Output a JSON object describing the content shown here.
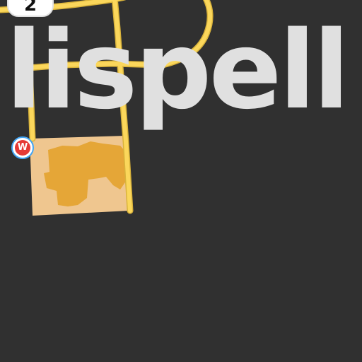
{
  "map": {
    "background_color": "#303030",
    "road_color": "#fbd75b",
    "landuse_color": "#efc68f",
    "building_color": "#e5a637",
    "city_label": {
      "text": "lispell",
      "color": "#e0e0e0"
    },
    "route_shield": {
      "number": "2",
      "icon": "us-highway-shield-icon"
    },
    "poi": {
      "letter": "W",
      "icon": "walmart-store-icon",
      "ring_color": "#42a5f5",
      "fill_color": "#e53935"
    }
  }
}
